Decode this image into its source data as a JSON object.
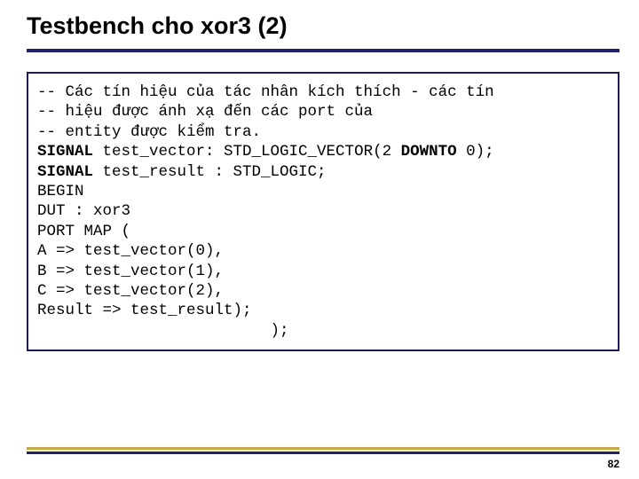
{
  "title": "Testbench cho xor3 (2)",
  "code": {
    "c1a": "-- Các tín hiệu của tác nhân kích thích ",
    "c1b": "- ",
    "c1c": "các tín",
    "c2": "-- hiệu được ánh xạ đến các port của ",
    "c3": "-- entity được kiểm tra.",
    "kw_signal1": "SIGNAL",
    "c4a": " test_vector: STD_LOGIC_VECTOR(2 ",
    "kw_downto": "DOWNTO",
    "c4b": " 0);",
    "kw_signal2": "SIGNAL",
    "c5": " test_result : STD_LOGIC;",
    "c6": "BEGIN",
    "c7": "DUT : xor3 ",
    "c8": "PORT MAP (",
    "c9": "A => test_vector(0),",
    "c10": "B => test_vector(1),",
    "c11": "C => test_vector(2),",
    "c12": "Result => test_result);",
    "c13": "                         );"
  },
  "page_number": "82"
}
